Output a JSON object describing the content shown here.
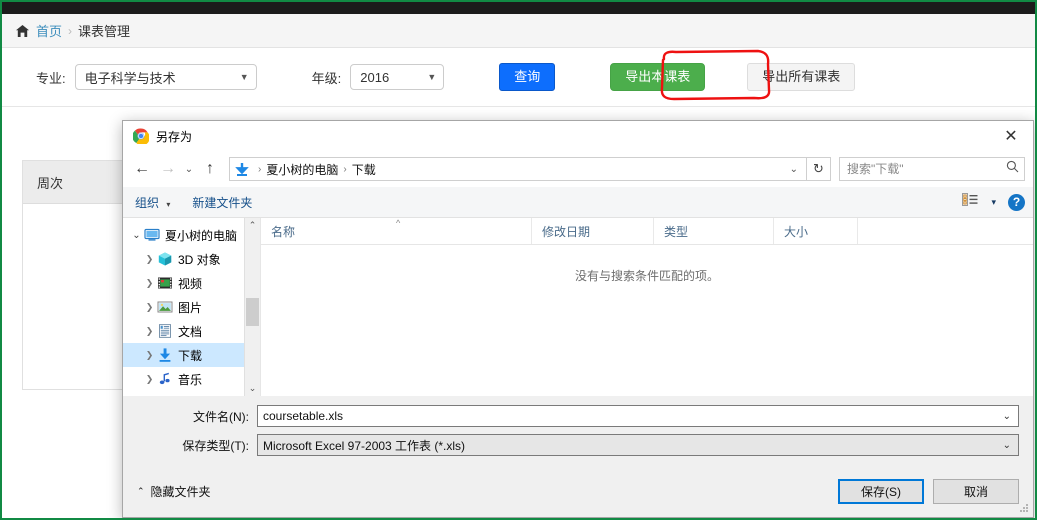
{
  "page": {
    "breadcrumb": {
      "home": "首页",
      "separator": "›",
      "current": "课表管理"
    },
    "filters": {
      "major_label": "专业:",
      "major_value": "电子科学与技术",
      "grade_label": "年级:",
      "grade_value": "2016"
    },
    "buttons": {
      "query": "查询",
      "export_this": "导出本课表",
      "export_all": "导出所有课表"
    },
    "table": {
      "header_week": "周次"
    },
    "accent_colors": {
      "primary_blue": "#0d6efd",
      "success_green": "#4cae4c",
      "link_blue": "#3c8dbc",
      "annotation_red": "#ee1111",
      "capture_border_green": "#118a44"
    }
  },
  "dialog": {
    "title": "另存为",
    "title_icon": "chrome-icon",
    "close_label": "✕",
    "nav": {
      "back_icon": "arrow-left-icon",
      "forward_icon": "arrow-right-icon",
      "history_icon": "chevron-down-icon",
      "up_icon": "arrow-up-icon",
      "address_icon": "download-folder-icon",
      "address_crumbs": [
        "夏小树的电脑",
        "下载"
      ],
      "address_caret": "⌄",
      "refresh_icon": "↻",
      "search_placeholder": "搜索\"下载\"",
      "search_value": "",
      "search_icon": "search-icon"
    },
    "toolbar": {
      "organize": "组织",
      "organize_caret": "▾",
      "new_folder": "新建文件夹",
      "view_icon": "view-options-icon",
      "view_caret": "▾",
      "help_icon": "?"
    },
    "tree": [
      {
        "label": "夏小树的电脑",
        "icon": "computer-icon",
        "expanded": true,
        "selected": false,
        "indent": 0
      },
      {
        "label": "3D 对象",
        "icon": "3d-objects-icon",
        "expanded": false,
        "selected": false,
        "indent": 1
      },
      {
        "label": "视频",
        "icon": "videos-icon",
        "expanded": false,
        "selected": false,
        "indent": 1
      },
      {
        "label": "图片",
        "icon": "pictures-icon",
        "expanded": false,
        "selected": false,
        "indent": 1
      },
      {
        "label": "文档",
        "icon": "documents-icon",
        "expanded": false,
        "selected": false,
        "indent": 1
      },
      {
        "label": "下载",
        "icon": "downloads-icon",
        "expanded": false,
        "selected": true,
        "indent": 1
      },
      {
        "label": "音乐",
        "icon": "music-icon",
        "expanded": false,
        "selected": false,
        "indent": 1
      }
    ],
    "columns": [
      "名称",
      "修改日期",
      "类型",
      "大小"
    ],
    "sort_indicator": "^",
    "empty_message": "没有与搜索条件匹配的项。",
    "fields": {
      "filename_label": "文件名(N):",
      "filename_value": "coursetable.xls",
      "filetype_label": "保存类型(T):",
      "filetype_value": "Microsoft Excel 97-2003 工作表 (*.xls)",
      "dropdown_caret": "⌄"
    },
    "footer": {
      "hide_folders": "隐藏文件夹",
      "hide_folders_chev": "⌃",
      "save": "保存(S)",
      "cancel": "取消"
    }
  }
}
